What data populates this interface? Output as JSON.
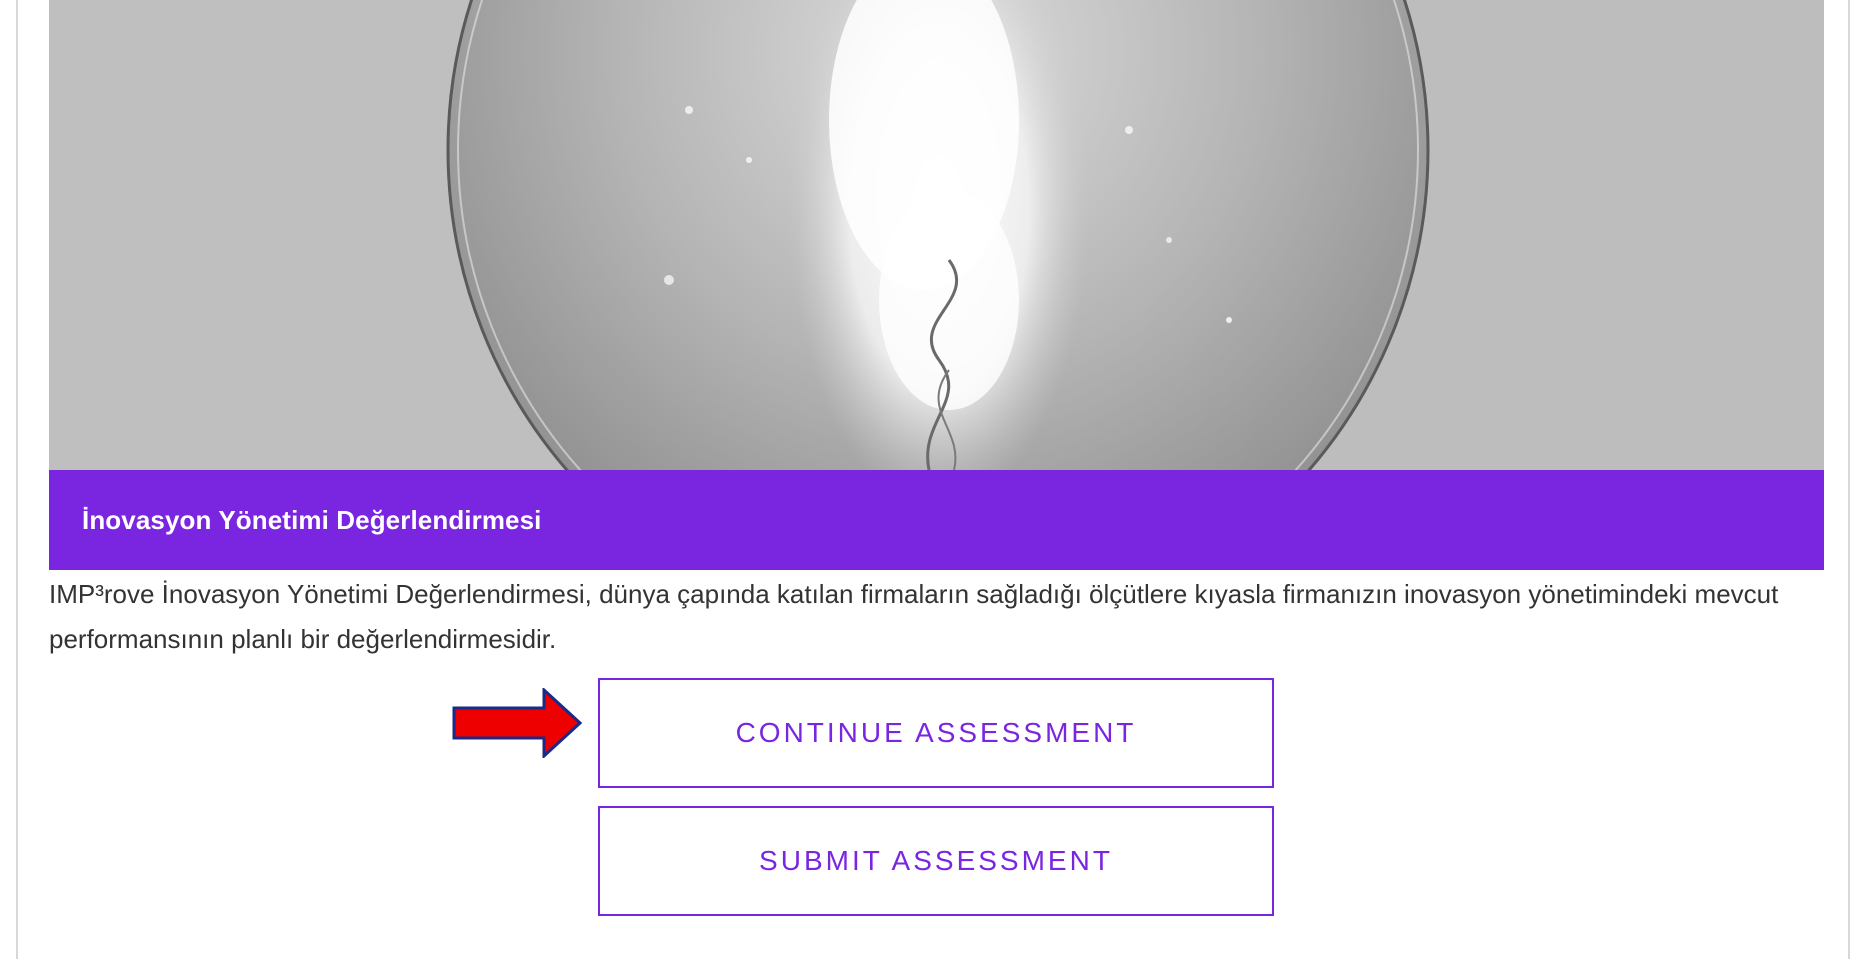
{
  "hero": {
    "image_subject": "light-bulb-filament"
  },
  "banner": {
    "title": "İnovasyon Yönetimi Değerlendirmesi",
    "color": "#7a26e0"
  },
  "description": "IMP³rove İnovasyon Yönetimi Değerlendirmesi, dünya çapında katılan firmaların sağladığı ölçütlere kıyasla firmanızın inovasyon yönetimindeki mevcut performansının planlı bir değerlendirmesidir.",
  "buttons": {
    "continue_label": "CONTINUE ASSESSMENT",
    "submit_label": "SUBMIT ASSESSMENT",
    "accent_color": "#7a26e0"
  },
  "annotation": {
    "icon": "red-arrow-icon",
    "color": "#ee0000"
  }
}
